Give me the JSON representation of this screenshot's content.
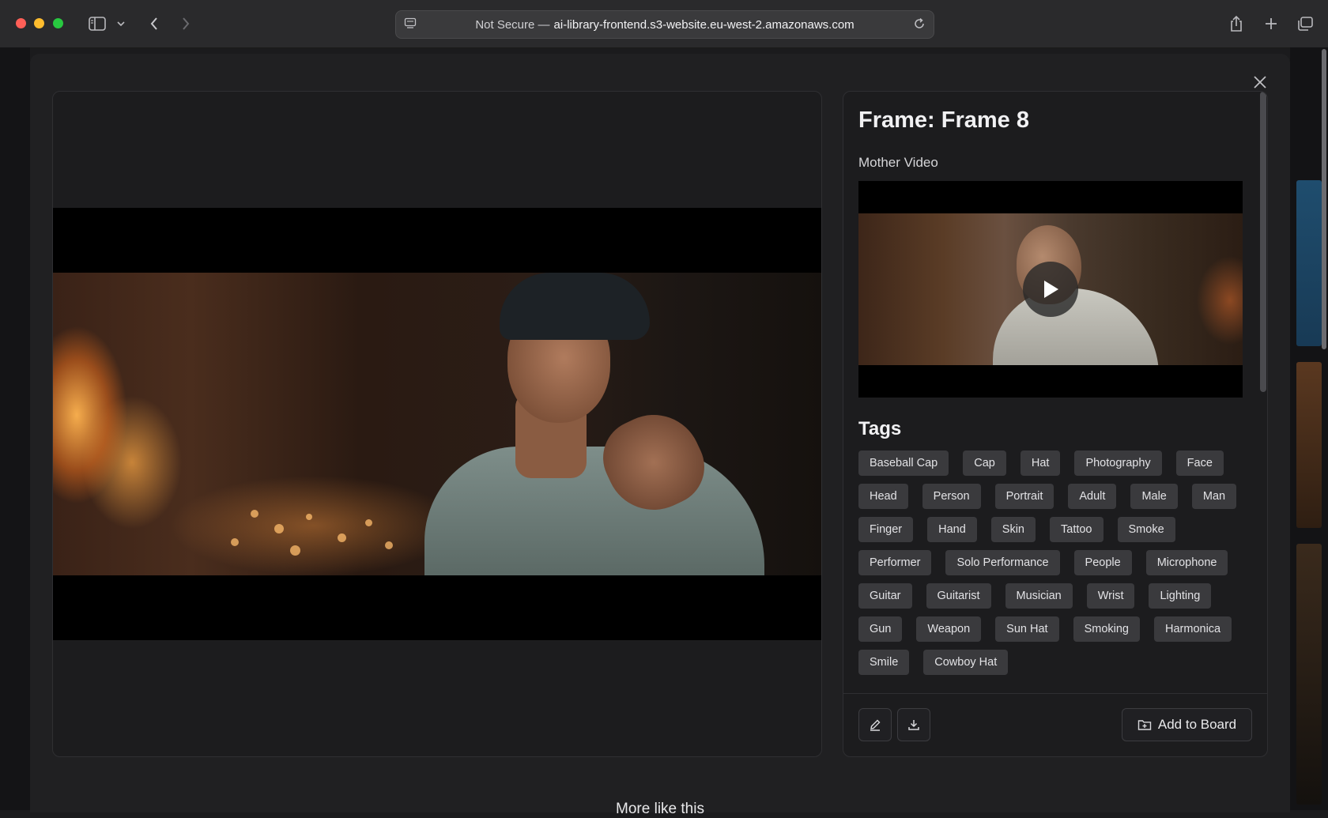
{
  "browser": {
    "url_prefix": "Not Secure —",
    "url_host": "ai-library-frontend.s3-website.eu-west-2.amazonaws.com",
    "icons": [
      "sidebar-icon",
      "chevron-down-icon",
      "back-icon",
      "forward-icon",
      "site-info-icon",
      "reload-icon",
      "share-icon",
      "new-tab-icon",
      "tabs-overview-icon"
    ]
  },
  "modal": {
    "frame_title": "Frame: Frame 8",
    "mother_video_label": "Mother Video",
    "tags_title": "Tags",
    "tags": [
      "Baseball Cap",
      "Cap",
      "Hat",
      "Photography",
      "Face",
      "Head",
      "Person",
      "Portrait",
      "Adult",
      "Male",
      "Man",
      "Finger",
      "Hand",
      "Skin",
      "Tattoo",
      "Smoke",
      "Performer",
      "Solo Performance",
      "People",
      "Microphone",
      "Guitar",
      "Guitarist",
      "Musician",
      "Wrist",
      "Lighting",
      "Gun",
      "Weapon",
      "Sun Hat",
      "Smoking",
      "Harmonica",
      "Smile",
      "Cowboy Hat"
    ],
    "actions": {
      "edit_icon": "pencil-icon",
      "download_icon": "download-icon",
      "add_to_board_label": "Add to Board",
      "add_to_board_icon": "folder-plus-icon"
    },
    "more_like_this": "More like this"
  },
  "colors": {
    "modal_bg": "#202022",
    "panel_bg": "#1c1c1e",
    "tag_bg": "#3a3a3d",
    "text_primary": "#f1f1f3"
  }
}
